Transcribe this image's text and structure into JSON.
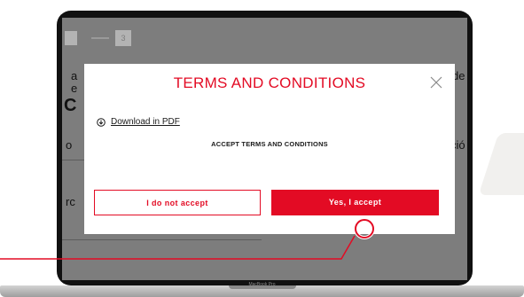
{
  "stepper": {
    "current_step": "3"
  },
  "background": {
    "frag_a": "a",
    "frag_e": "e",
    "frag_de": "de",
    "frag_o": "o",
    "frag_cio": "ció",
    "frag_rc": "rc",
    "frag_big": "C"
  },
  "modal": {
    "title": "TERMS AND CONDITIONS",
    "download_link": "Download in PDF",
    "accept_heading": "ACCEPT TERMS AND CONDITIONS",
    "decline_label": "I do not accept",
    "accept_label": "Yes, I accept"
  },
  "device": {
    "label": "MacBook Pro"
  },
  "colors": {
    "accent": "#e30b24",
    "overlay": "#7d7d7d"
  }
}
